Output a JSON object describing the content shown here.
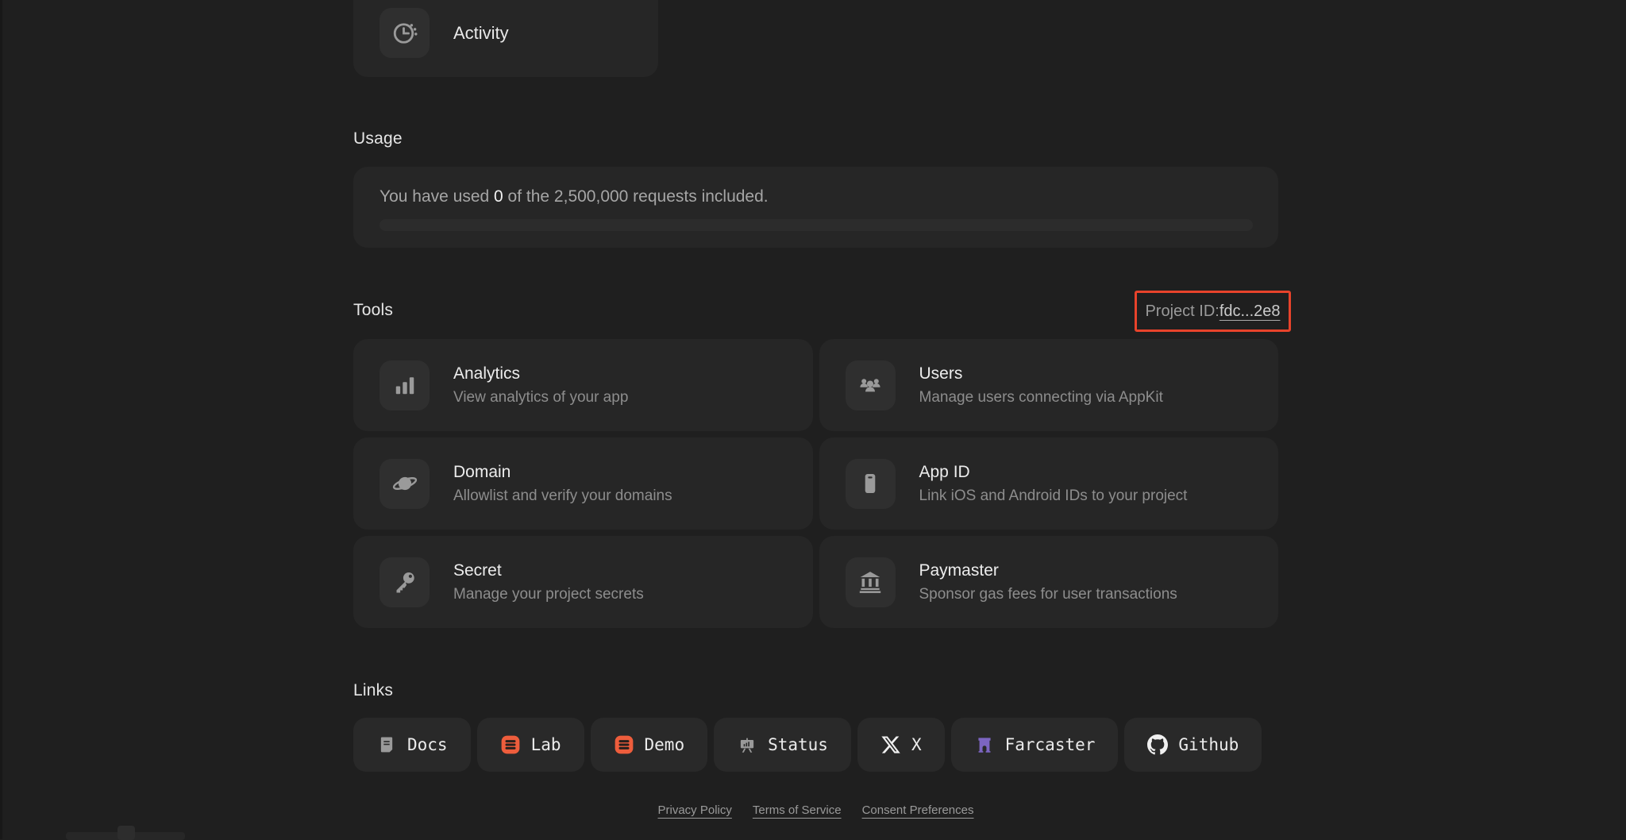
{
  "activity_card": {
    "label": "Activity",
    "icon": "clock-activity-icon"
  },
  "usage": {
    "heading": "Usage",
    "text_prefix": "You have used ",
    "used_value": "0",
    "text_suffix": " of the 2,500,000 requests included.",
    "progress_percent": 0
  },
  "tools": {
    "heading": "Tools",
    "project_id": {
      "label": "Project ID: ",
      "value": "fdc...2e8",
      "highlight_color": "#e8432b"
    },
    "cards": [
      {
        "title": "Analytics",
        "description": "View analytics of your app",
        "icon": "bar-chart-icon"
      },
      {
        "title": "Users",
        "description": "Manage users connecting via AppKit",
        "icon": "users-icon"
      },
      {
        "title": "Domain",
        "description": "Allowlist and verify your domains",
        "icon": "planet-icon"
      },
      {
        "title": "App ID",
        "description": "Link iOS and Android IDs to your project",
        "icon": "phone-icon"
      },
      {
        "title": "Secret",
        "description": "Manage your project secrets",
        "icon": "key-icon"
      },
      {
        "title": "Paymaster",
        "description": "Sponsor gas fees for user transactions",
        "icon": "bank-icon"
      }
    ]
  },
  "links": {
    "heading": "Links",
    "items": [
      {
        "label": "Docs",
        "icon": "document-icon"
      },
      {
        "label": "Lab",
        "icon": "reown-lab-icon",
        "icon_color": "#ee5d3c"
      },
      {
        "label": "Demo",
        "icon": "reown-demo-icon",
        "icon_color": "#ee5d3c"
      },
      {
        "label": "Status",
        "icon": "status-board-icon"
      },
      {
        "label": "X",
        "icon": "x-logo-icon"
      },
      {
        "label": "Farcaster",
        "icon": "farcaster-icon",
        "icon_color": "#7c65c1"
      },
      {
        "label": "Github",
        "icon": "github-icon"
      }
    ]
  },
  "footer": {
    "links": [
      "Privacy Policy",
      "Terms of Service",
      "Consent Preferences"
    ]
  },
  "colors": {
    "page_background": "#1f1f1f",
    "card_background": "#262626",
    "tile_background": "#2f2f2f",
    "button_background": "#292929",
    "accent_orange": "#ee5d3c",
    "farcaster_purple": "#7c65c1",
    "highlight_red": "#e8432b"
  }
}
